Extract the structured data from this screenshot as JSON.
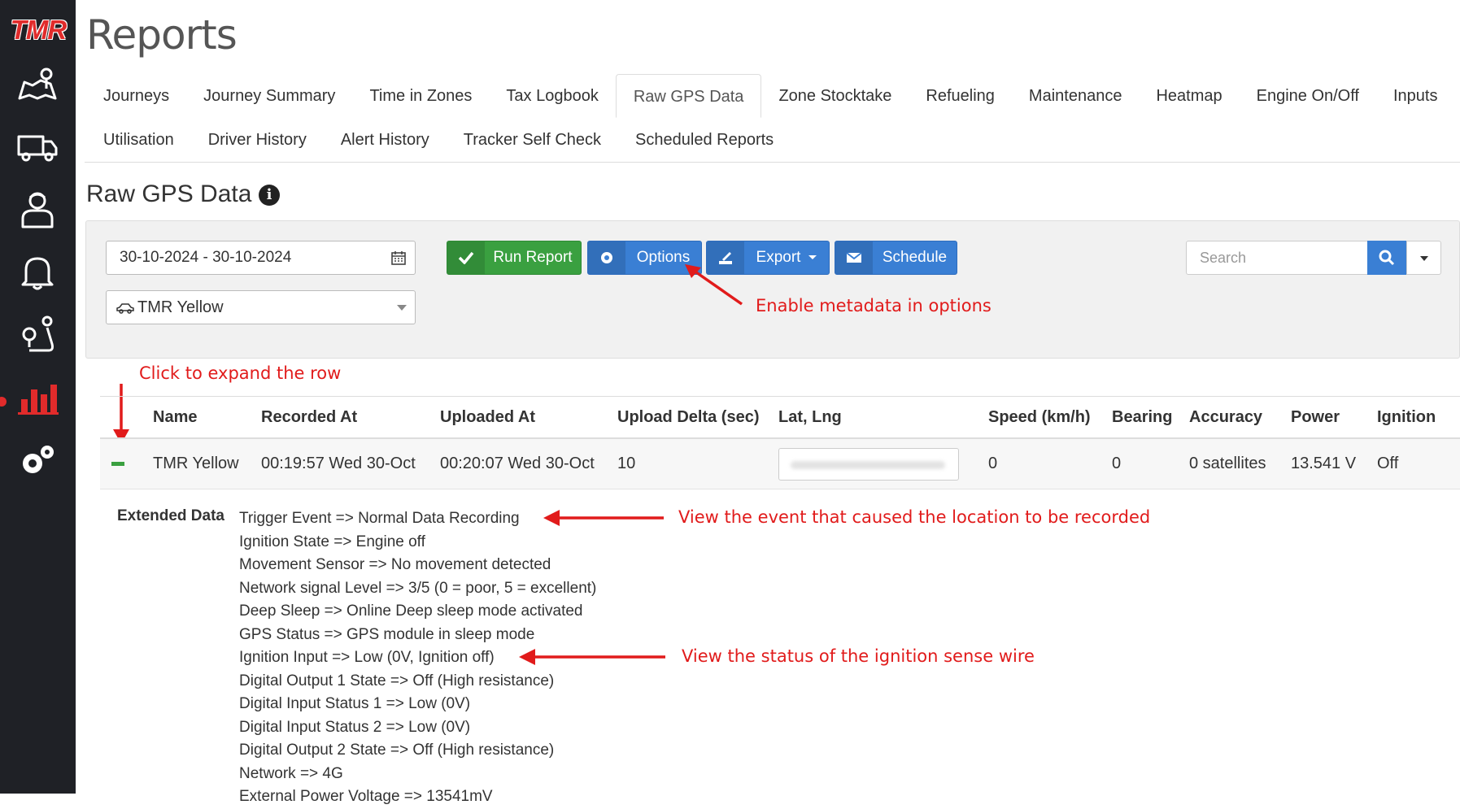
{
  "sidebar": {
    "logo_text": "TMR",
    "items": [
      {
        "name": "map-route-icon"
      },
      {
        "name": "truck-icon"
      },
      {
        "name": "driver-icon"
      },
      {
        "name": "alert-bell-icon"
      },
      {
        "name": "location-route-icon"
      },
      {
        "name": "reports-chart-icon",
        "active": true
      },
      {
        "name": "settings-gears-icon"
      }
    ],
    "accent_color": "#e12b2b"
  },
  "header": {
    "title": "Reports"
  },
  "tabs": {
    "row1": [
      "Journeys",
      "Journey Summary",
      "Time in Zones",
      "Tax Logbook",
      "Raw GPS Data",
      "Zone Stocktake",
      "Refueling",
      "Maintenance",
      "Heatmap",
      "Engine On/Off",
      "Inputs"
    ],
    "row2": [
      "Utilisation",
      "Driver History",
      "Alert History",
      "Tracker Self Check",
      "Scheduled Reports"
    ],
    "active": "Raw GPS Data"
  },
  "section": {
    "title": "Raw GPS Data"
  },
  "filters": {
    "date_range": "30-10-2024 - 30-10-2024",
    "vehicle": "TMR Yellow",
    "search_placeholder": "Search"
  },
  "buttons": {
    "run_report": "Run Report",
    "options": "Options",
    "export": "Export",
    "schedule": "Schedule"
  },
  "annotations": {
    "options_hint": "Enable metadata in options",
    "expand_hint": "Click to expand the row",
    "event_hint": "View the event that caused the location to be recorded",
    "ignition_hint": "View the status of the ignition sense wire"
  },
  "table": {
    "columns": [
      "Name",
      "Recorded At",
      "Uploaded At",
      "Upload Delta (sec)",
      "Lat, Lng",
      "Speed (km/h)",
      "Bearing",
      "Accuracy",
      "Power",
      "Ignition"
    ],
    "rows": [
      {
        "name": "TMR Yellow",
        "recorded_at": "00:19:57 Wed 30-Oct",
        "uploaded_at": "00:20:07 Wed 30-Oct",
        "upload_delta": "10",
        "speed": "0",
        "bearing": "0",
        "accuracy": "0 satellites",
        "power": "13.541 V",
        "ignition": "Off"
      }
    ]
  },
  "extended": {
    "label": "Extended Data",
    "items": [
      "Trigger Event => Normal Data Recording",
      "Ignition State => Engine off",
      "Movement Sensor => No movement detected",
      "Network signal Level => 3/5 (0 = poor, 5 = excellent)",
      "Deep Sleep => Online Deep sleep mode activated",
      "GPS Status => GPS module in sleep mode",
      "Ignition Input => Low (0V, Ignition off)",
      "Digital Output 1 State => Off (High resistance)",
      "Digital Input Status 1 => Low (0V)",
      "Digital Input Status 2 => Low (0V)",
      "Digital Output 2 State => Off (High resistance)",
      "Network => 4G",
      "External Power Voltage => 13541mV"
    ]
  }
}
